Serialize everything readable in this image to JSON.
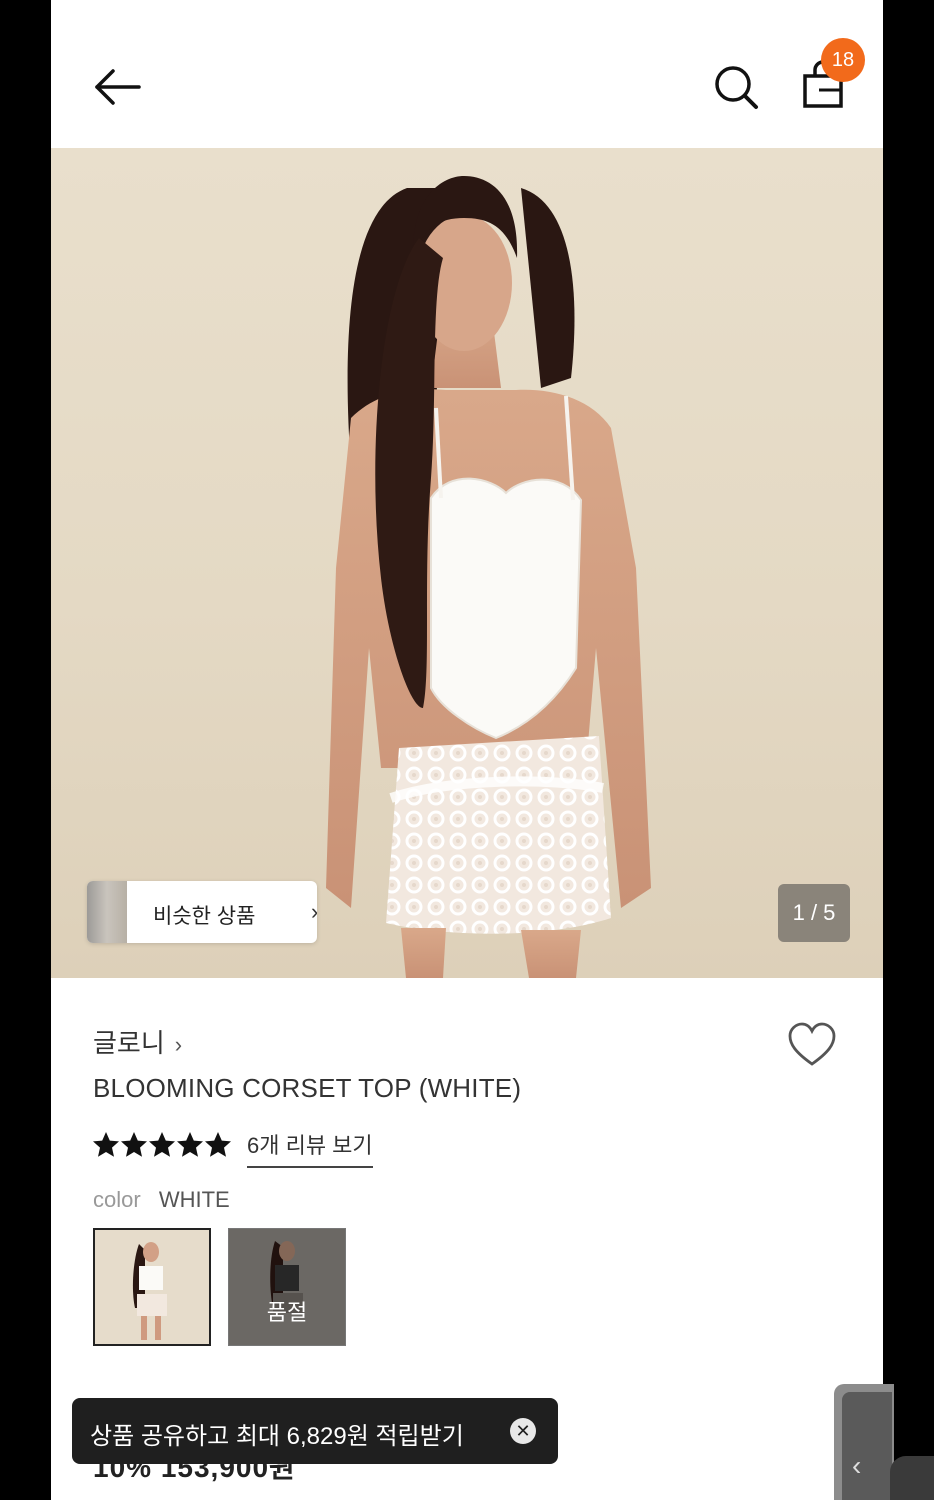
{
  "header": {
    "back_icon": "arrow-left-icon",
    "search_icon": "search-icon",
    "bag_icon": "shopping-bag-icon",
    "bag_count": "18"
  },
  "hero": {
    "similar_label": "비슷한 상품",
    "similar_chevron": "›",
    "page_indicator": "1 / 5"
  },
  "product": {
    "brand": "글로니",
    "brand_chevron": "›",
    "name": "BLOOMING CORSET TOP (WHITE)",
    "rating_stars": 5,
    "review_link": "6개 리뷰 보기",
    "color_key": "color",
    "color_value": "WHITE",
    "swatches": [
      {
        "name": "white",
        "selected": true
      },
      {
        "name": "black",
        "soldout_label": "품절"
      }
    ],
    "price_partial": "10% 153,900원"
  },
  "toast": {
    "text": "상품 공유하고 최대 6,829원 적립받기",
    "close_icon": "close-icon"
  },
  "colors": {
    "accent": "#f26a1b",
    "toast_bg": "#1f1f1f"
  }
}
